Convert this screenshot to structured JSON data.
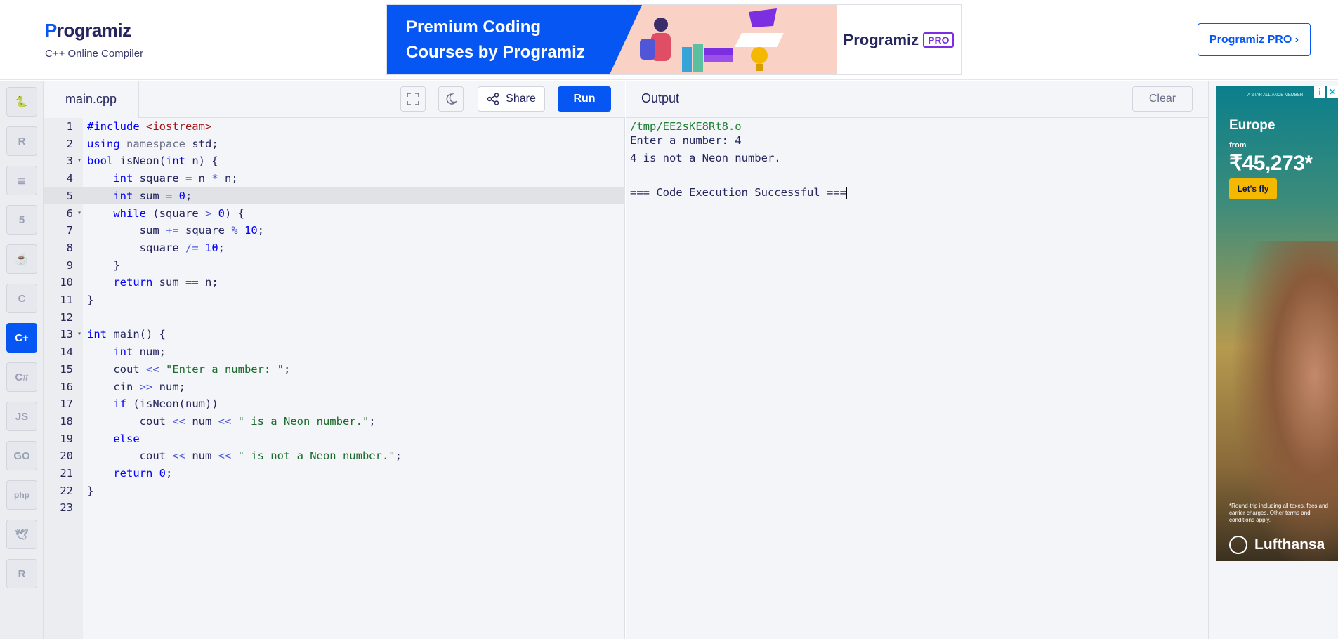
{
  "header": {
    "logo_text": "rogramiz",
    "logo_mark": "P",
    "subtitle": "C++ Online Compiler",
    "banner_line1": "Premium Coding",
    "banner_line2": "Courses by Programiz",
    "banner_brand": "Programiz",
    "banner_pro": "PRO",
    "pro_button": "Programiz PRO ›"
  },
  "sidebar": {
    "items": [
      {
        "name": "python-icon",
        "glyph": "🐍",
        "active": false
      },
      {
        "name": "r-icon",
        "glyph": "R",
        "active": false
      },
      {
        "name": "sql-icon",
        "glyph": "≣",
        "active": false
      },
      {
        "name": "html-icon",
        "glyph": "5",
        "active": false
      },
      {
        "name": "java-icon",
        "glyph": "☕",
        "active": false
      },
      {
        "name": "c-icon",
        "glyph": "C",
        "active": false
      },
      {
        "name": "cpp-icon",
        "glyph": "C+",
        "active": true
      },
      {
        "name": "csharp-icon",
        "glyph": "C#",
        "active": false
      },
      {
        "name": "javascript-icon",
        "glyph": "JS",
        "active": false
      },
      {
        "name": "go-icon",
        "glyph": "GO",
        "active": false
      },
      {
        "name": "php-icon",
        "glyph": "php",
        "active": false
      },
      {
        "name": "swift-icon",
        "glyph": "🕊",
        "active": false
      },
      {
        "name": "rust-icon",
        "glyph": "R",
        "active": false
      }
    ]
  },
  "editor": {
    "filename": "main.cpp",
    "share_label": "Share",
    "run_label": "Run",
    "active_line": 5,
    "lines": [
      "#include <iostream>",
      "using namespace std;",
      "bool isNeon(int n) {",
      "    int square = n * n;",
      "    int sum = 0;",
      "    while (square > 0) {",
      "        sum += square % 10;",
      "        square /= 10;",
      "    }",
      "    return sum == n;",
      "}",
      "",
      "int main() {",
      "    int num;",
      "    cout << \"Enter a number: \";",
      "    cin >> num;",
      "    if (isNeon(num))",
      "        cout << num << \" is a Neon number.\";",
      "    else",
      "        cout << num << \" is not a Neon number.\";",
      "    return 0;",
      "}",
      ""
    ],
    "fold_lines": [
      3,
      6,
      13
    ]
  },
  "output": {
    "title": "Output",
    "clear_label": "Clear",
    "path": "/tmp/EE2sKE8Rt8.o",
    "lines": [
      "Enter a number: 4",
      "4 is not a Neon number.",
      "",
      "=== Code Execution Successful ==="
    ]
  },
  "ad": {
    "top_text": "A STAR ALLIANCE MEMBER",
    "destination": "Europe",
    "from_label": "from",
    "price": "₹45,273*",
    "cta": "Let's fly",
    "fine_print": "*Round-trip including all taxes, fees and carrier charges. Other terms and conditions apply.",
    "brand": "Lufthansa",
    "info_glyph": "i",
    "close_glyph": "✕"
  },
  "colors": {
    "accent": "#0556f3",
    "keyword": "#0000ff",
    "string": "#1a6b2c",
    "number": "#0000ff",
    "include": "#a31515",
    "text": "#25265e"
  }
}
